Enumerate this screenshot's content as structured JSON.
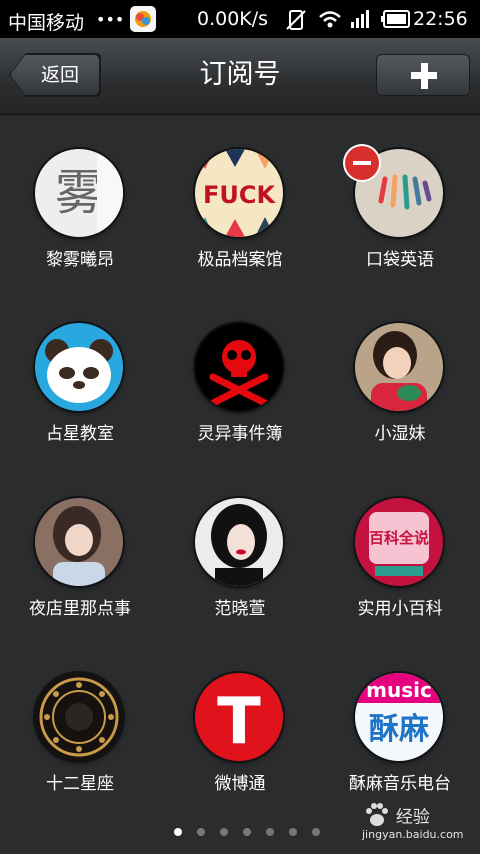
{
  "status_bar": {
    "carrier": "中国移动",
    "speed": "0.00K/s",
    "time": "22:56",
    "icons": [
      "notification-dots-icon",
      "app-icon",
      "vibrate-off-icon",
      "wifi-icon",
      "signal-icon",
      "battery-icon"
    ]
  },
  "header": {
    "back_label": "返回",
    "title": "订阅号",
    "add_icon": "plus-icon"
  },
  "accounts": [
    {
      "name": "黎雾曦昂"
    },
    {
      "name": "极品档案馆"
    },
    {
      "name": "口袋英语",
      "removable": true
    },
    {
      "name": "占星教室"
    },
    {
      "name": "灵异事件簿"
    },
    {
      "name": "小湿妹"
    },
    {
      "name": "夜店里那点事"
    },
    {
      "name": "范晓萱"
    },
    {
      "name": "实用小百科"
    },
    {
      "name": "十二星座"
    },
    {
      "name": "微博通"
    },
    {
      "name": "酥麻音乐电台"
    }
  ],
  "avatar_text": {
    "fuck": "FUCK",
    "fog": "雾",
    "t": "T",
    "music": "music",
    "suma": "酥麻",
    "baike": "百科全说"
  },
  "pager": {
    "count": 7,
    "active": 0
  },
  "watermark": {
    "site": "jingyan.baidu.com",
    "brand": "经验"
  }
}
